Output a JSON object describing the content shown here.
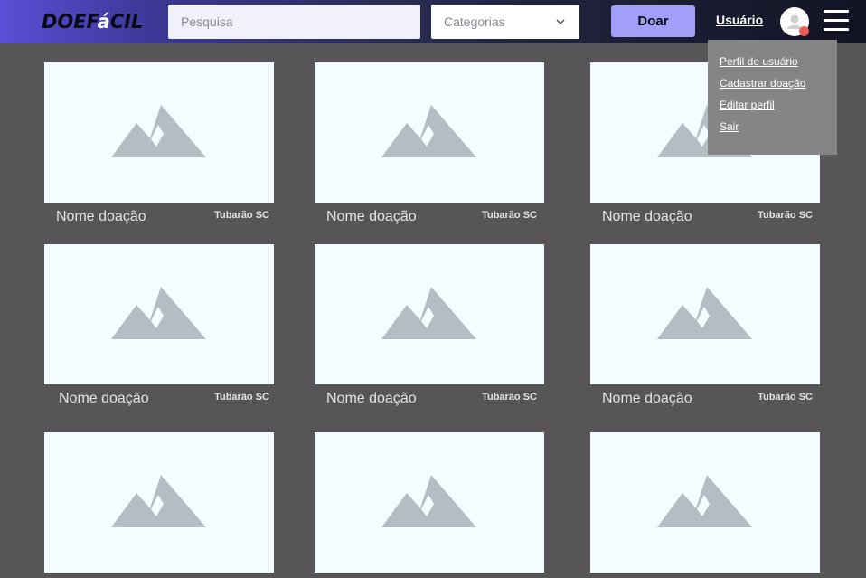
{
  "header": {
    "logo_main": "DOEF",
    "logo_accent": "á",
    "logo_end": "CIL",
    "search_placeholder": "Pesquisa",
    "categories_label": "Categorias",
    "donate_label": "Doar",
    "user_label": "Usuário"
  },
  "user_menu": {
    "items": [
      {
        "label": "Perfil de usuário"
      },
      {
        "label": "Cadastrar doação"
      },
      {
        "label": "Editar perfil"
      },
      {
        "label": "Sair"
      }
    ]
  },
  "cards": [
    {
      "name": "Nome doação",
      "location": "Tubarão SC"
    },
    {
      "name": "Nome doação",
      "location": "Tubarão SC"
    },
    {
      "name": "Nome doação",
      "location": "Tubarão SC"
    },
    {
      "name": "Nome doação",
      "location": "Tubarão SC"
    },
    {
      "name": "Nome doação",
      "location": "Tubarão SC"
    },
    {
      "name": "Nome doação",
      "location": "Tubarão SC"
    },
    {
      "name": "",
      "location": ""
    },
    {
      "name": "",
      "location": ""
    },
    {
      "name": "",
      "location": ""
    }
  ],
  "colors": {
    "background": "#575558",
    "donate_button": "#a29ff8",
    "card_placeholder": "#f3fcff",
    "placeholder_icon": "#b2bec3",
    "notification_dot": "#ef5a5a",
    "menu_background": "#858585"
  },
  "icons": [
    "image-placeholder-icon",
    "chevron-down-icon",
    "user-avatar-icon",
    "hamburger-menu-icon"
  ]
}
